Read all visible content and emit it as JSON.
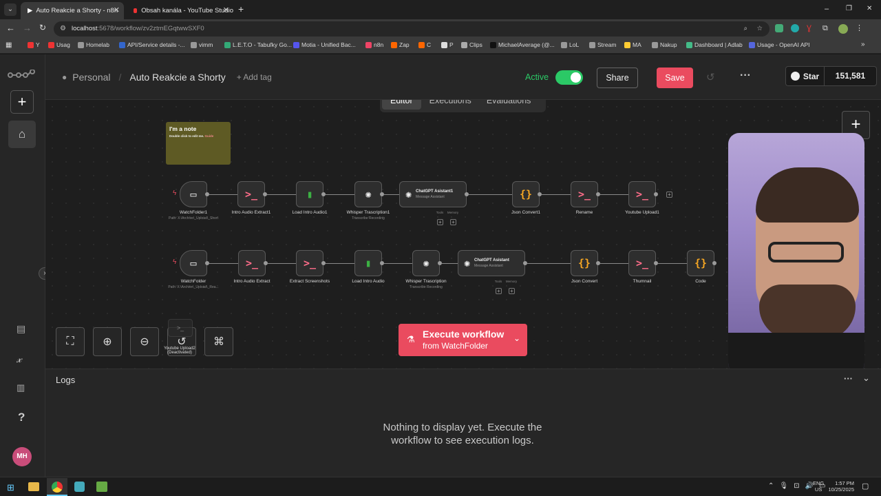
{
  "browser": {
    "tabs": [
      {
        "title": "Auto Reakcie a Shorty - n8n"
      },
      {
        "title": "Obsah kanála - YouTube Studio"
      }
    ],
    "new_tab": "+",
    "url_host": "localhost",
    "url_path": ":5678/workflow/zv2ztmEGqtwwSXF0",
    "window_controls": [
      "–",
      "❐",
      "✕"
    ],
    "bookmarks": [
      "Y",
      "Usag",
      "Homelab",
      "API/Service details -...",
      "vimm",
      "L.E.T.O - Tabuľky Go...",
      "Motia - Unified Bac...",
      "n8n",
      "Zap",
      "C",
      "P",
      "Clips",
      "MichaelAverage (@...",
      "LoL",
      "Stream",
      "MA",
      "Nakup",
      "Dashboard | Adlab",
      "Usage - OpenAI API"
    ]
  },
  "header": {
    "project": "Personal",
    "separator": "/",
    "workflow_name": "Auto Reakcie a Shorty",
    "add_tag": "+ Add tag",
    "active_label": "Active",
    "share": "Share",
    "save": "Save",
    "more": "···",
    "star": "Star",
    "star_count": "151,581",
    "tabs": [
      "Editor",
      "Executions",
      "Evaluations"
    ]
  },
  "sidebar": {
    "avatar": "MH",
    "help": "?"
  },
  "canvas": {
    "note_title": "I'm a note",
    "note_body": "Double click to edit me.",
    "note_link": "Guide",
    "row1": [
      {
        "label": "WatchFolder1",
        "sub": "Path: X:\\Archive\\_Upload\\_Short",
        "icon": "folder"
      },
      {
        "label": "Intro Audio Extract1",
        "sub": "",
        "icon": "terminal"
      },
      {
        "label": "Load Intro Audio1",
        "sub": "",
        "icon": "file"
      },
      {
        "label": "Whisper Trascription1",
        "sub": "Transcribe Recording",
        "icon": "openai"
      },
      {
        "label": "ChatGPT Asistant1",
        "sub": "Message Assistant",
        "icon": "openai"
      },
      {
        "label": "Json Convert1",
        "sub": "",
        "icon": "code"
      },
      {
        "label": "Rename",
        "sub": "",
        "icon": "terminal"
      },
      {
        "label": "Youtube Upload1",
        "sub": "",
        "icon": "terminal"
      }
    ],
    "row2": [
      {
        "label": "WatchFolder",
        "sub": "Path: X:\\Archive\\_Upload\\_Rea...",
        "icon": "folder"
      },
      {
        "label": "Intro Audio Extract",
        "sub": "",
        "icon": "terminal"
      },
      {
        "label": "Extract Screenshots",
        "sub": "",
        "icon": "terminal"
      },
      {
        "label": "Load Intro Audio",
        "sub": "",
        "icon": "file"
      },
      {
        "label": "Whisper Trascription",
        "sub": "Transcribe Recording",
        "icon": "openai"
      },
      {
        "label": "ChatGPT Asistant",
        "sub": "Message Assistant",
        "icon": "openai"
      },
      {
        "label": "Json Convert",
        "sub": "",
        "icon": "code"
      },
      {
        "label": "Thumnail",
        "sub": "",
        "icon": "terminal"
      },
      {
        "label": "Code",
        "sub": "",
        "icon": "code"
      }
    ],
    "tools_label": "Tools",
    "memory_label": "Memory",
    "deactivated_node": "Youtube Upload2",
    "deactivated_tag": "(Deactivated)",
    "execute_title": "Execute workflow",
    "execute_sub": "from WatchFolder"
  },
  "logs": {
    "title": "Logs",
    "empty_line1": "Nothing to display yet. Execute the",
    "empty_line2": "workflow to see execution logs."
  },
  "taskbar": {
    "lang": "ENG",
    "region": "US",
    "time": "1:57 PM",
    "date": "10/25/2025"
  },
  "colors": {
    "accent_red": "#ea4b5f",
    "active_green": "#2bc966",
    "note_yellow": "#5e5a24",
    "terminal_pink": "#ff6d8a",
    "code_orange": "#f5a623"
  }
}
